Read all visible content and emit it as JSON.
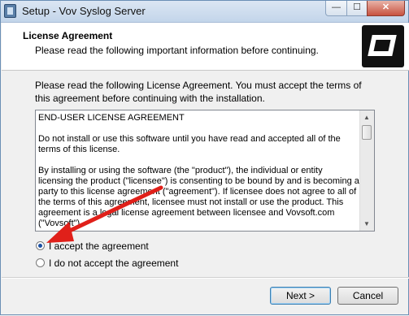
{
  "window": {
    "title": "Setup - Vov Syslog Server",
    "controls": {
      "minimize": "—",
      "maximize": "☐",
      "close": "✕"
    }
  },
  "header": {
    "title": "License Agreement",
    "subtitle": "Please read the following important information before continuing.",
    "logo_icon": "installer-logo-icon"
  },
  "intro_text": "Please read the following License Agreement. You must accept the terms of this agreement before continuing with the installation.",
  "license": {
    "paragraphs": [
      "END-USER LICENSE AGREEMENT",
      "Do not install or use this software until you have read and accepted all of the terms of this license.",
      "By installing or using the software (the \"product\"), the individual or entity licensing the product (\"licensee\") is consenting to be bound by and is becoming a party to this license agreement (\"agreement\"). If licensee does not agree to all of the terms of this agreement, licensee must not install or use the product. This agreement is a legal license agreement between licensee and Vovsoft.com (\"Vovsoft\")."
    ]
  },
  "options": {
    "accept_label": "I accept the agreement",
    "decline_label": "I do not accept the agreement",
    "selected": "accept"
  },
  "buttons": {
    "next": "Next >",
    "cancel": "Cancel"
  },
  "colors": {
    "annotation_arrow": "#e0201a",
    "accent": "#3c7fb1"
  }
}
